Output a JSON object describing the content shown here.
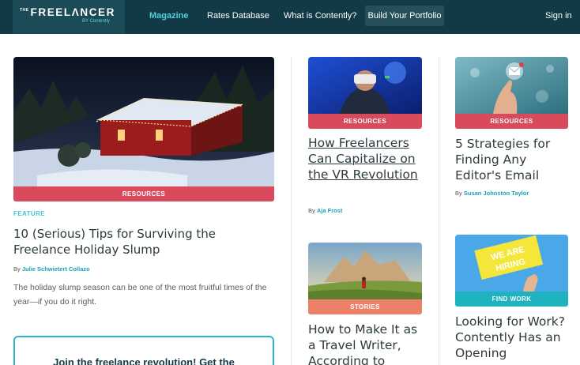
{
  "nav": {
    "logo_main": "FREELΛNCER",
    "logo_the": "THE",
    "logo_sub": "BY Contently",
    "items": [
      {
        "label": "Magazine",
        "active": true
      },
      {
        "label": "Rates Database"
      },
      {
        "label": "What is Contently?"
      },
      {
        "label": "Build Your Portfolio"
      },
      {
        "label": "Sign in"
      }
    ]
  },
  "featured": {
    "tag": "RESOURCES",
    "kicker": "FEATURE",
    "title": "10 (Serious) Tips for Surviving the Freelance Holiday Slump",
    "by": "By",
    "author": "Julie Schwietert Collazo",
    "desc": "The holiday slump season can be one of the most fruitful times of the year—if you do it right."
  },
  "promo": {
    "text": "Join the freelance revolution! Get the"
  },
  "articles": [
    {
      "tag": "RESOURCES",
      "title": "How Freelancers Can Capitalize on the VR Revolution",
      "by": "By",
      "author": "Aja Frost"
    },
    {
      "tag": "RESOURCES",
      "title": "5 Strategies for Finding Any Editor's Email",
      "by": "By",
      "author": "Susan Johnston Taylor"
    },
    {
      "tag": "STORIES",
      "title": "How to Make It as a Travel Writer, According to"
    },
    {
      "tag": "FIND WORK",
      "title": "Looking for Work? Contently Has an Opening",
      "sign": "WE ARE HIRING"
    }
  ],
  "colors": {
    "nav_bg": "#123a46",
    "accent": "#4fd1e0",
    "tag_red": "#d94a5c",
    "tag_orange": "#ec8069",
    "tag_teal": "#1fb3bf"
  }
}
